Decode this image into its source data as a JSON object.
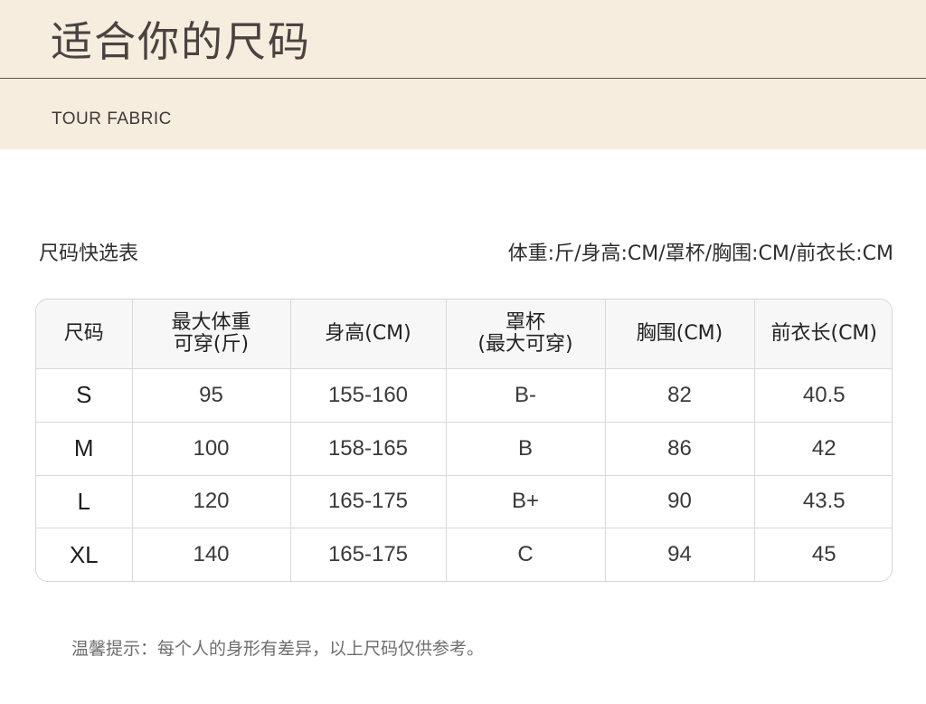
{
  "header": {
    "title": "适合你的尺码",
    "subtitle": "TOUR FABRIC"
  },
  "section": {
    "label": "尺码快选表",
    "units": "体重:斤/身高:CM/罩杯/胸围:CM/前衣长:CM"
  },
  "table": {
    "headers": [
      [
        "尺码"
      ],
      [
        "最大体重",
        "可穿(斤)"
      ],
      [
        "身高(CM)"
      ],
      [
        "罩杯",
        "(最大可穿)"
      ],
      [
        "胸围(CM)"
      ],
      [
        "前衣长(CM)"
      ]
    ],
    "rows": [
      [
        "S",
        "95",
        "155-160",
        "B-",
        "82",
        "40.5"
      ],
      [
        "M",
        "100",
        "158-165",
        "B",
        "86",
        "42"
      ],
      [
        "L",
        "120",
        "165-175",
        "B+",
        "90",
        "43.5"
      ],
      [
        "XL",
        "140",
        "165-175",
        "C",
        "94",
        "45"
      ]
    ]
  },
  "footnote": "温馨提示：每个人的身形有差异，以上尺码仅供参考。",
  "colors": {
    "header_band": "#f7eddf",
    "table_header_bg": "#f7f7f7",
    "border": "#d9d9d9"
  }
}
